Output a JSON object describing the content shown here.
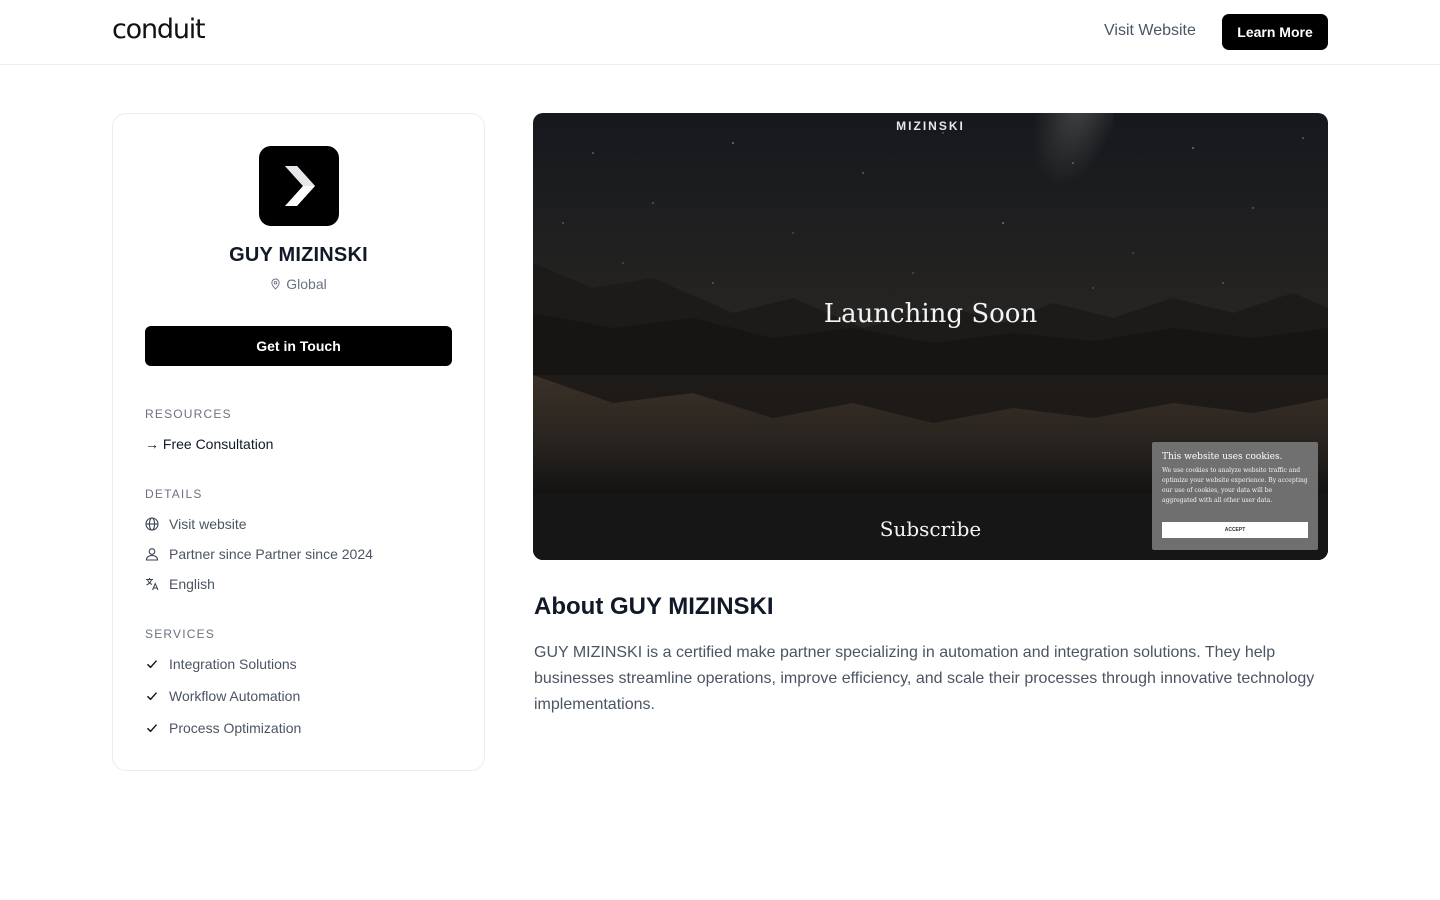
{
  "header": {
    "logo": "conduit",
    "visit_label": "Visit Website",
    "learn_label": "Learn More"
  },
  "profile": {
    "name": "GUY MIZINSKI",
    "location": "Global",
    "cta_label": "Get in Touch"
  },
  "resources": {
    "title": "RESOURCES",
    "items": [
      {
        "label": "→ Free Consultation"
      }
    ]
  },
  "details": {
    "title": "DETAILS",
    "website": "Visit website",
    "partner": "Partner since Partner since 2024",
    "language": "English"
  },
  "services": {
    "title": "SERVICES",
    "items": [
      "Integration Solutions",
      "Workflow Automation",
      "Process Optimization"
    ]
  },
  "preview": {
    "brand": "MIZINSKI",
    "headline": "Launching Soon",
    "subscribe": "Subscribe",
    "cookie_title": "This website uses cookies.",
    "cookie_body": "We use cookies to analyze website traffic and optimize your website experience. By accepting our use of cookies, your data will be aggregated with all other user data.",
    "cookie_accept": "ACCEPT"
  },
  "about": {
    "title": "About GUY MIZINSKI",
    "text": "GUY MIZINSKI is a certified make partner specializing in automation and integration solutions. They help businesses streamline operations, improve efficiency, and scale their processes through innovative technology implementations."
  },
  "colors": {
    "primary": "#000000",
    "text": "#111827",
    "muted": "#6b7280",
    "border": "#ececec"
  }
}
